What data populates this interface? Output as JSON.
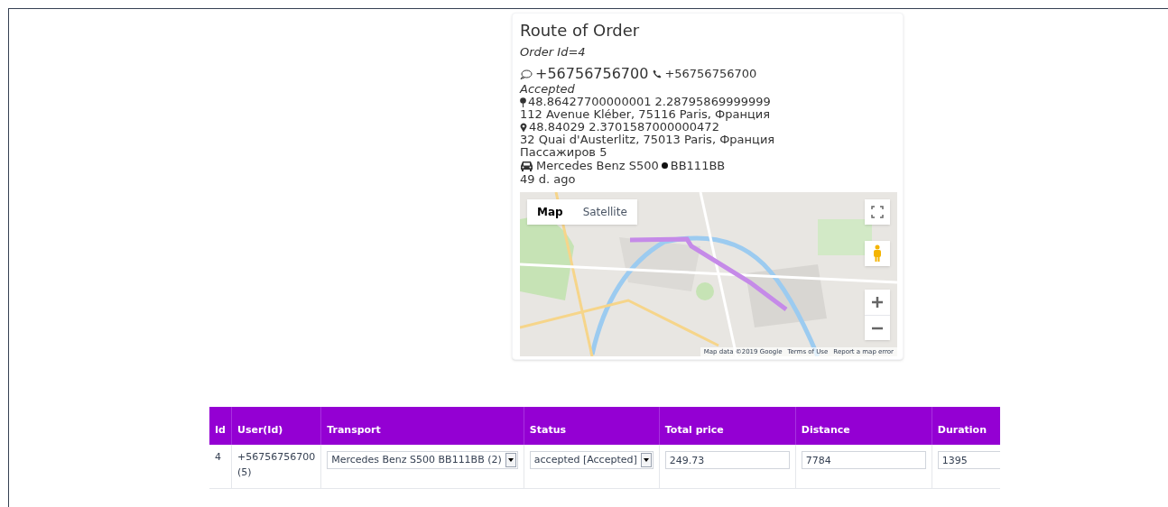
{
  "route": {
    "title": "Route of Order",
    "order_id": "Order Id=4",
    "sms_phone": "+56756756700",
    "call_phone": "+56756756700",
    "status": "Accepted",
    "from_coords": "48.86427700000001 2.28795869999999",
    "from_address": "112 Avenue Kléber, 75116 Paris, Франция",
    "to_coords": "48.84029 2.3701587000000472",
    "to_address": "32 Quai d'Austerlitz, 75013 Paris, Франция",
    "passengers": "Пассажиров 5",
    "car": "Mercedes Benz S500",
    "plate": "BB111BB",
    "age": "49 d. ago",
    "map": {
      "kind": "picture",
      "types": [
        {
          "label": "Map",
          "selected": true
        },
        {
          "label": "Satellite",
          "selected": false
        }
      ],
      "attribution": [
        "Map data ©2019 Google",
        "Terms of Use",
        "Report a map error"
      ]
    }
  },
  "table": {
    "columns": [
      "Id",
      "User(Id)",
      "Transport",
      "Status",
      "Total price",
      "Distance",
      "Duration"
    ],
    "rows": [
      {
        "id": "4",
        "user": "+56756756700",
        "user_id": "(5)",
        "transport": "Mercedes Benz S500 BB111BB (2)",
        "status": "accepted [Accepted]",
        "total_price": "249.73",
        "distance": "7784",
        "duration": "1395"
      }
    ]
  }
}
